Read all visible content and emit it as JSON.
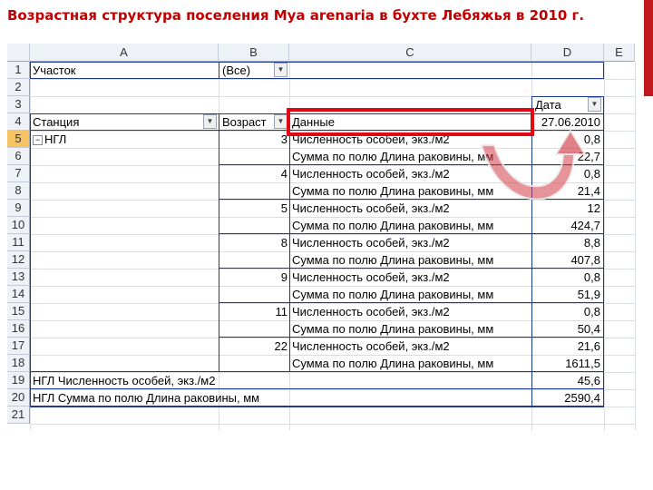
{
  "slide": {
    "title": "Возрастная структура поселения Mya arenaria в бухте Лебяжья в 2010 г."
  },
  "columns": [
    "A",
    "B",
    "C",
    "D",
    "E"
  ],
  "rows": [
    "1",
    "2",
    "3",
    "4",
    "5",
    "6",
    "7",
    "8",
    "9",
    "10",
    "11",
    "12",
    "13",
    "14",
    "15",
    "16",
    "17",
    "18",
    "19",
    "20",
    "21"
  ],
  "filter": {
    "label": "Участок",
    "value": "(Все)"
  },
  "pivot": {
    "date_label": "Дата",
    "date_value": "27.06.2010",
    "station_label": "Станция",
    "age_label": "Возраст",
    "data_label": "Данные",
    "station_name": "НГЛ",
    "collapse_symbol": "−",
    "groups": [
      {
        "age": "3",
        "count": "0,8",
        "length": "22,7"
      },
      {
        "age": "4",
        "count": "0,8",
        "length": "21,4"
      },
      {
        "age": "5",
        "count": "12",
        "length": "424,7"
      },
      {
        "age": "8",
        "count": "8,8",
        "length": "407,8"
      },
      {
        "age": "9",
        "count": "0,8",
        "length": "51,9"
      },
      {
        "age": "11",
        "count": "0,8",
        "length": "50,4"
      },
      {
        "age": "22",
        "count": "21,6",
        "length": "1611,5"
      }
    ],
    "measure_count": "Численность особей, экз./м2",
    "measure_length": "Сумма по полю Длина раковины, мм",
    "total_count_label": "НГЛ Численность особей, экз./м2",
    "total_count": "45,6",
    "total_length_label": "НГЛ Сумма по полю Длина раковины, мм",
    "total_length": "2590,4"
  },
  "accent_color": "#e30613"
}
